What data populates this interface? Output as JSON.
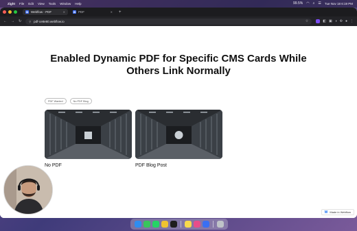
{
  "menubar": {
    "app_name": "Zight",
    "items": [
      "File",
      "Edit",
      "View",
      "Tools",
      "Window",
      "Help"
    ],
    "clock": "Tue Nov 18  6:19 PM",
    "battery": "99.5%"
  },
  "browser": {
    "tabs": [
      {
        "title": "Webflow - PDF",
        "active": true,
        "favicon": "W"
      },
      {
        "title": "PDF",
        "active": false,
        "favicon": "W"
      }
    ],
    "url": "pdf-ce8e80.webflow.io"
  },
  "page": {
    "headline_line1": "Enabled Dynamic PDF for Specific CMS Cards While",
    "headline_line2": "Others Link Normally",
    "filters": [
      "PDF Wanted",
      "No PDF Blog"
    ],
    "cards": [
      {
        "label": "No PDF"
      },
      {
        "label": "PDF Blog Post"
      }
    ],
    "badge": "Made in Webflow"
  },
  "dock": {
    "icons": [
      {
        "name": "finder-icon",
        "color": "#2f8df0"
      },
      {
        "name": "messages-icon",
        "color": "#39c55c"
      },
      {
        "name": "whatsapp-icon",
        "color": "#25d366"
      },
      {
        "name": "chrome-icon",
        "color": "#f0c330"
      },
      {
        "name": "figma-icon",
        "color": "#1e1e1e"
      },
      {
        "name": "notes-icon",
        "color": "#f7d94c"
      },
      {
        "name": "photos-icon",
        "color": "#e84d8a"
      },
      {
        "name": "browser-icon",
        "color": "#3a6ff2"
      },
      {
        "name": "trash-icon",
        "color": "#bfc3c8"
      }
    ]
  }
}
